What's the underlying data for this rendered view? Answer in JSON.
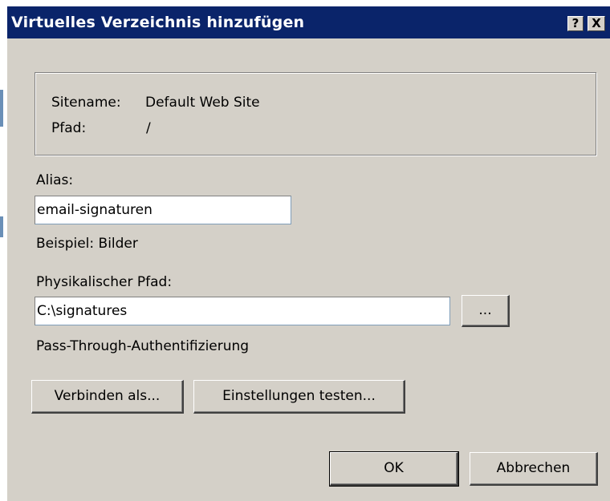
{
  "dialog": {
    "title": "Virtuelles Verzeichnis hinzufügen",
    "help_glyph": "?",
    "close_glyph": "X"
  },
  "info": {
    "sitename_label": "Sitename:",
    "sitename_value": "Default Web Site",
    "path_label": "Pfad:",
    "path_value": "/"
  },
  "alias": {
    "label": "Alias:",
    "value": "email-signaturen",
    "example": "Beispiel: Bilder"
  },
  "physical_path": {
    "label": "Physikalischer Pfad:",
    "value": "C:\\signatures",
    "browse_label": "...",
    "auth_text": "Pass-Through-Authentifizierung"
  },
  "buttons": {
    "connect_as": "Verbinden als...",
    "test_settings": "Einstellungen testen...",
    "ok": "OK",
    "cancel": "Abbrechen"
  },
  "colors": {
    "titlebar": "#0a246a",
    "dialog_face": "#d4d0c8",
    "input_bg": "#ffffff"
  }
}
